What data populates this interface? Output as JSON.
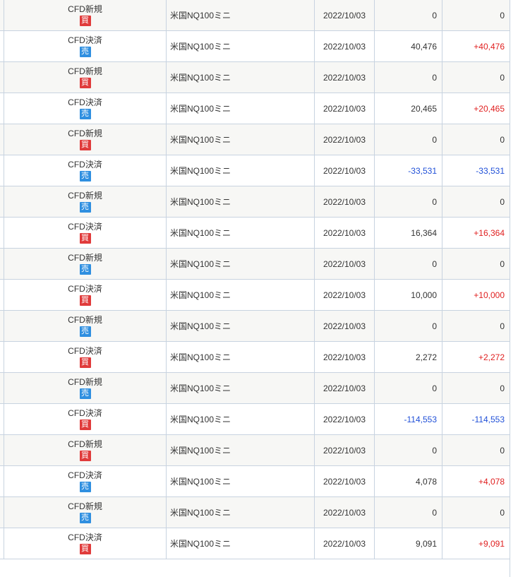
{
  "colors": {
    "buy_badge": "#e03b3b",
    "sell_badge": "#2f8fe0",
    "positive": "#e02020",
    "negative": "#2050d8",
    "row_alt": "#f7f7f5",
    "border": "#c8d3e0"
  },
  "rows": [
    {
      "type": "CFD新規",
      "side": "買",
      "side_kind": "buy",
      "product": "米国NQ100ミニ",
      "date": "2022/10/03",
      "amount": "0",
      "amount_sign": "zero",
      "pnl": "0",
      "pnl_sign": "zero"
    },
    {
      "type": "CFD決済",
      "side": "売",
      "side_kind": "sell",
      "product": "米国NQ100ミニ",
      "date": "2022/10/03",
      "amount": "40,476",
      "amount_sign": "zero",
      "pnl": "+40,476",
      "pnl_sign": "plus"
    },
    {
      "type": "CFD新規",
      "side": "買",
      "side_kind": "buy",
      "product": "米国NQ100ミニ",
      "date": "2022/10/03",
      "amount": "0",
      "amount_sign": "zero",
      "pnl": "0",
      "pnl_sign": "zero"
    },
    {
      "type": "CFD決済",
      "side": "売",
      "side_kind": "sell",
      "product": "米国NQ100ミニ",
      "date": "2022/10/03",
      "amount": "20,465",
      "amount_sign": "zero",
      "pnl": "+20,465",
      "pnl_sign": "plus"
    },
    {
      "type": "CFD新規",
      "side": "買",
      "side_kind": "buy",
      "product": "米国NQ100ミニ",
      "date": "2022/10/03",
      "amount": "0",
      "amount_sign": "zero",
      "pnl": "0",
      "pnl_sign": "zero"
    },
    {
      "type": "CFD決済",
      "side": "売",
      "side_kind": "sell",
      "product": "米国NQ100ミニ",
      "date": "2022/10/03",
      "amount": "-33,531",
      "amount_sign": "minus",
      "pnl": "-33,531",
      "pnl_sign": "minus"
    },
    {
      "type": "CFD新規",
      "side": "売",
      "side_kind": "sell",
      "product": "米国NQ100ミニ",
      "date": "2022/10/03",
      "amount": "0",
      "amount_sign": "zero",
      "pnl": "0",
      "pnl_sign": "zero"
    },
    {
      "type": "CFD決済",
      "side": "買",
      "side_kind": "buy",
      "product": "米国NQ100ミニ",
      "date": "2022/10/03",
      "amount": "16,364",
      "amount_sign": "zero",
      "pnl": "+16,364",
      "pnl_sign": "plus"
    },
    {
      "type": "CFD新規",
      "side": "売",
      "side_kind": "sell",
      "product": "米国NQ100ミニ",
      "date": "2022/10/03",
      "amount": "0",
      "amount_sign": "zero",
      "pnl": "0",
      "pnl_sign": "zero"
    },
    {
      "type": "CFD決済",
      "side": "買",
      "side_kind": "buy",
      "product": "米国NQ100ミニ",
      "date": "2022/10/03",
      "amount": "10,000",
      "amount_sign": "zero",
      "pnl": "+10,000",
      "pnl_sign": "plus"
    },
    {
      "type": "CFD新規",
      "side": "売",
      "side_kind": "sell",
      "product": "米国NQ100ミニ",
      "date": "2022/10/03",
      "amount": "0",
      "amount_sign": "zero",
      "pnl": "0",
      "pnl_sign": "zero"
    },
    {
      "type": "CFD決済",
      "side": "買",
      "side_kind": "buy",
      "product": "米国NQ100ミニ",
      "date": "2022/10/03",
      "amount": "2,272",
      "amount_sign": "zero",
      "pnl": "+2,272",
      "pnl_sign": "plus"
    },
    {
      "type": "CFD新規",
      "side": "売",
      "side_kind": "sell",
      "product": "米国NQ100ミニ",
      "date": "2022/10/03",
      "amount": "0",
      "amount_sign": "zero",
      "pnl": "0",
      "pnl_sign": "zero"
    },
    {
      "type": "CFD決済",
      "side": "買",
      "side_kind": "buy",
      "product": "米国NQ100ミニ",
      "date": "2022/10/03",
      "amount": "-114,553",
      "amount_sign": "minus",
      "pnl": "-114,553",
      "pnl_sign": "minus"
    },
    {
      "type": "CFD新規",
      "side": "買",
      "side_kind": "buy",
      "product": "米国NQ100ミニ",
      "date": "2022/10/03",
      "amount": "0",
      "amount_sign": "zero",
      "pnl": "0",
      "pnl_sign": "zero"
    },
    {
      "type": "CFD決済",
      "side": "売",
      "side_kind": "sell",
      "product": "米国NQ100ミニ",
      "date": "2022/10/03",
      "amount": "4,078",
      "amount_sign": "zero",
      "pnl": "+4,078",
      "pnl_sign": "plus"
    },
    {
      "type": "CFD新規",
      "side": "売",
      "side_kind": "sell",
      "product": "米国NQ100ミニ",
      "date": "2022/10/03",
      "amount": "0",
      "amount_sign": "zero",
      "pnl": "0",
      "pnl_sign": "zero"
    },
    {
      "type": "CFD決済",
      "side": "買",
      "side_kind": "buy",
      "product": "米国NQ100ミニ",
      "date": "2022/10/03",
      "amount": "9,091",
      "amount_sign": "zero",
      "pnl": "+9,091",
      "pnl_sign": "plus"
    }
  ]
}
